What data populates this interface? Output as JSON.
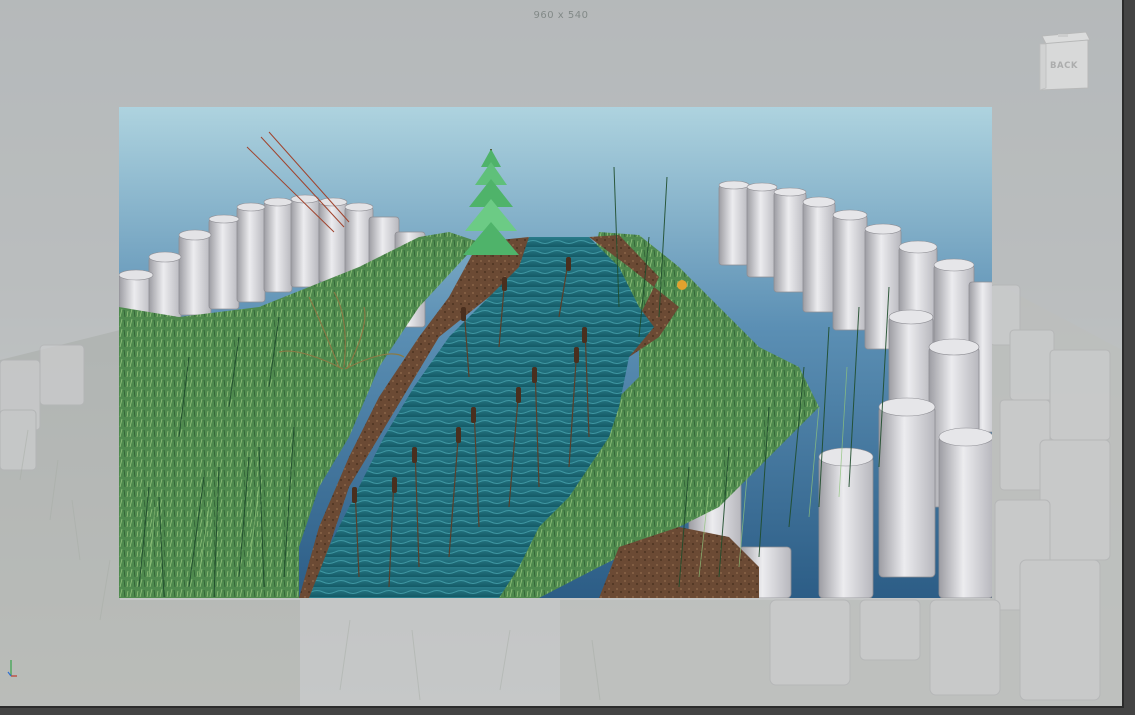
{
  "viewport": {
    "resolution_gate_label": "960 x 540"
  },
  "viewcube": {
    "face_label": "BACK",
    "icon": "viewcube-icon"
  },
  "axis_indicator": {
    "icon": "axis-gizmo-icon"
  },
  "colors": {
    "sky_top": "#2c5d86",
    "sky_bottom": "#aed3df",
    "water": "#1d6a78",
    "grass": "#4f8a4e",
    "mud": "#6b4a34",
    "cylinder": "#d6d6da"
  }
}
